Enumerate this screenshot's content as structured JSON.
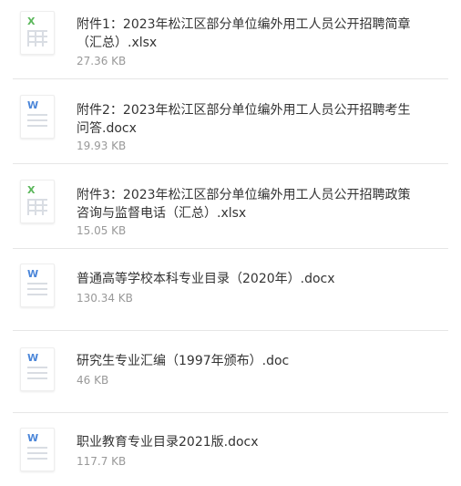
{
  "files": [
    {
      "name": "附件1：2023年松江区部分单位编外用工人员公开招聘简章（汇总）.xlsx",
      "size": "27.36 KB",
      "type": "xlsx",
      "icon": "excel-file-icon",
      "glyph": "X"
    },
    {
      "name": "附件2：2023年松江区部分单位编外用工人员公开招聘考生问答.docx",
      "size": "19.93 KB",
      "type": "docx",
      "icon": "word-file-icon",
      "glyph": "W"
    },
    {
      "name": "附件3：2023年松江区部分单位编外用工人员公开招聘政策咨询与监督电话（汇总）.xlsx",
      "size": "15.05 KB",
      "type": "xlsx",
      "icon": "excel-file-icon",
      "glyph": "X"
    },
    {
      "name": "普通高等学校本科专业目录（2020年）.docx",
      "size": "130.34 KB",
      "type": "docx",
      "icon": "word-file-icon",
      "glyph": "W"
    },
    {
      "name": "研究生专业汇编（1997年颁布）.doc",
      "size": "46 KB",
      "type": "doc",
      "icon": "word-file-icon",
      "glyph": "W"
    },
    {
      "name": "职业教育专业目录2021版.docx",
      "size": "117.7 KB",
      "type": "docx",
      "icon": "word-file-icon",
      "glyph": "W"
    }
  ],
  "colors": {
    "excel": "#5bb75b",
    "word": "#4b86d9",
    "text": "#333333",
    "meta": "#999999",
    "divider": "#e6e6e6"
  }
}
